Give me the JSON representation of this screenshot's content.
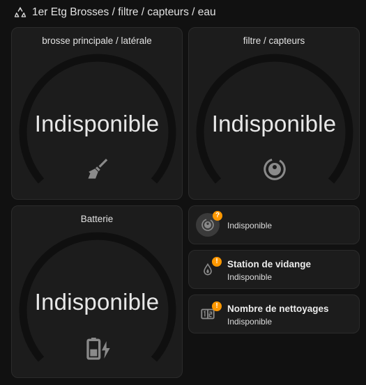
{
  "header": {
    "title": "1er Etg Brosses / filtre / capteurs / eau",
    "icon": "recycle-icon"
  },
  "gauges": [
    {
      "title": "brosse principale / latérale",
      "value": "Indisponible",
      "icon": "broom-icon"
    },
    {
      "title": "filtre / capteurs",
      "value": "Indisponible",
      "icon": "robot-vacuum-icon"
    },
    {
      "title": "Batterie",
      "value": "Indisponible",
      "icon": "battery-charging-icon"
    }
  ],
  "tiles": [
    {
      "name": "",
      "state": "Indisponible",
      "icon": "robot-vacuum-icon",
      "badge": "?"
    },
    {
      "name": "Station de vidange",
      "state": "Indisponible",
      "icon": "water-fire-icon",
      "badge": "!"
    },
    {
      "name": "Nombre de nettoyages",
      "state": "Indisponible",
      "icon": "counter-icon",
      "badge": "!"
    }
  ],
  "colors": {
    "background": "#111111",
    "card": "#1c1c1c",
    "arc": "#0f0f0f",
    "badge": "#ff9800",
    "icon": "#8a8a8a"
  }
}
